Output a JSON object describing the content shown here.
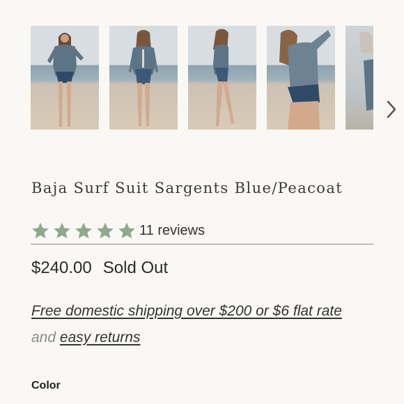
{
  "gallery": {
    "images": [
      {
        "alt": "Model wearing suit, front view"
      },
      {
        "alt": "Model wearing suit, back view"
      },
      {
        "alt": "Model wearing suit, side view"
      },
      {
        "alt": "Model wearing suit, close-up"
      },
      {
        "alt": "Next image preview"
      }
    ],
    "next_icon": "chevron-right-icon"
  },
  "product": {
    "title": "Baja Surf Suit Sargents Blue/Peacoat",
    "rating": {
      "stars": 5,
      "max_stars": 5,
      "reviews_label": "11 reviews",
      "star_color": "#8fa88e"
    },
    "price": "$240.00",
    "availability": "Sold Out",
    "shipping_text": "Free domestic shipping over $200 or $6 flat rate",
    "returns_prefix": "and",
    "returns_link": "easy returns",
    "color_label": "Color"
  },
  "colors": {
    "background": "#faf8f4",
    "text": "#2b2b2b",
    "star": "#8fa88e",
    "suit_top": "#5d7486",
    "suit_bottom": "#2e4a66"
  }
}
